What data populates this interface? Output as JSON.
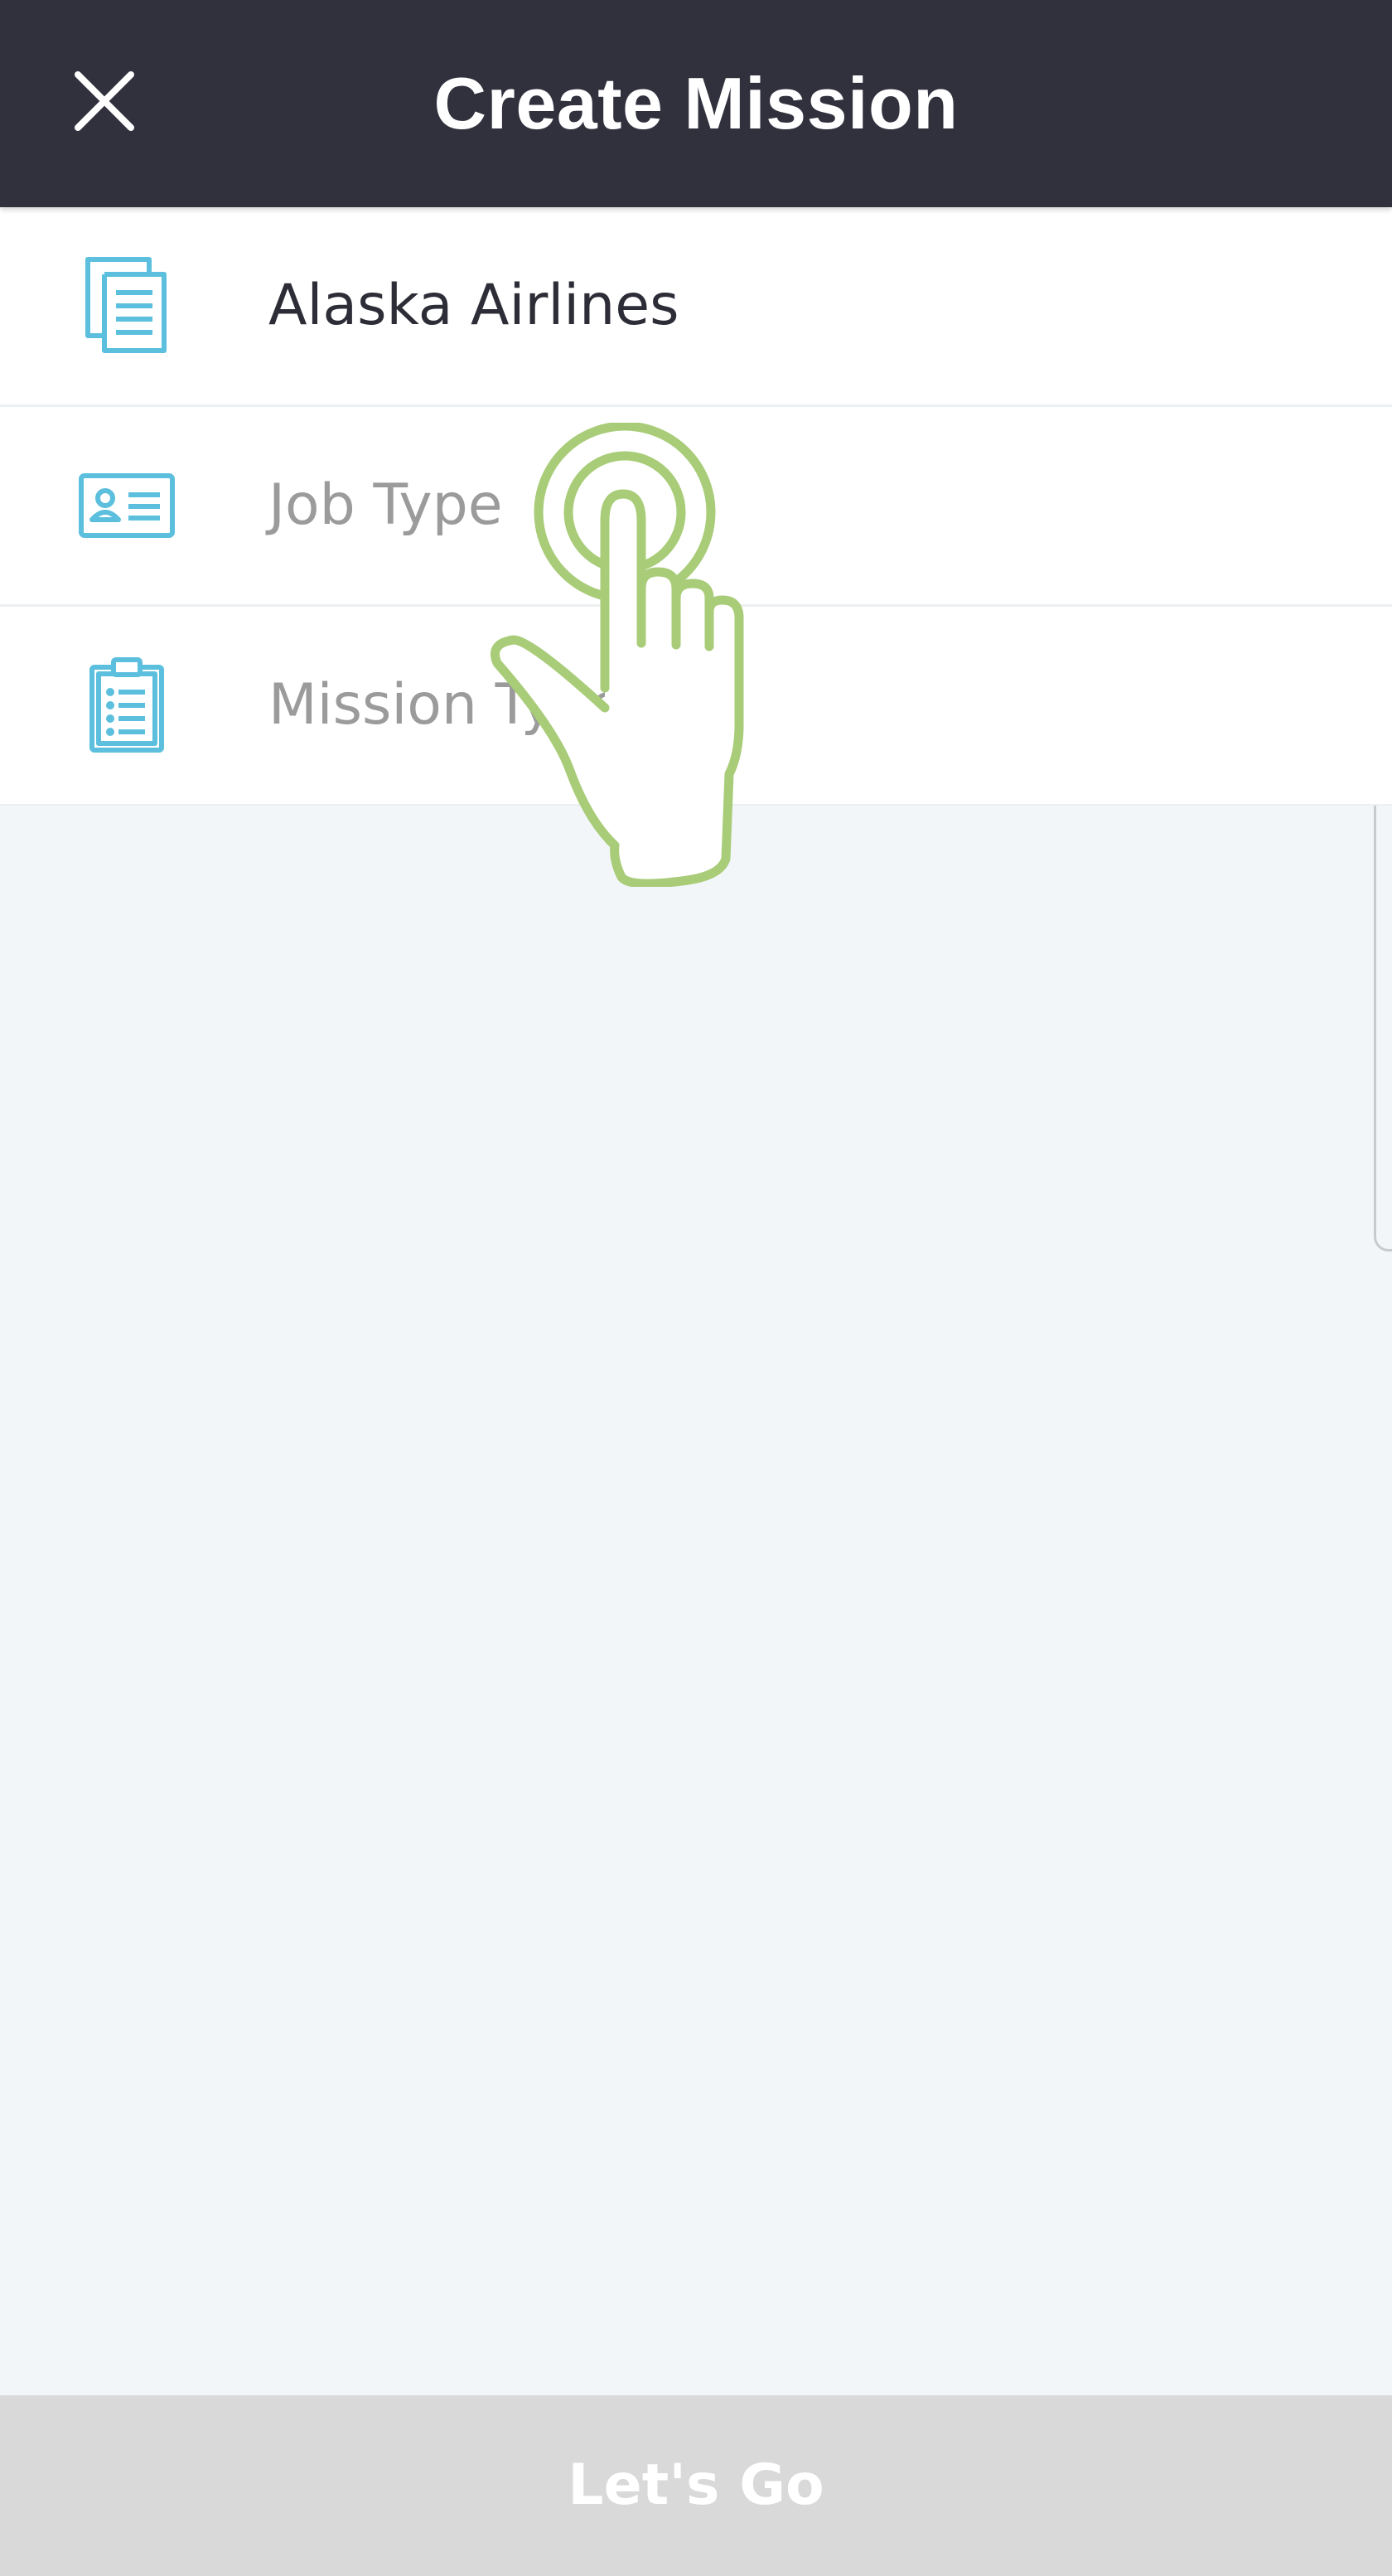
{
  "header": {
    "title": "Create Mission",
    "close_icon": "close-icon"
  },
  "form": {
    "fields": [
      {
        "icon": "document-icon",
        "value": "Alaska Airlines",
        "placeholder": ""
      },
      {
        "icon": "id-card-icon",
        "value": "",
        "placeholder": "Job Type"
      },
      {
        "icon": "clipboard-icon",
        "value": "",
        "placeholder": "Mission Type"
      }
    ]
  },
  "footer": {
    "submit_label": "Let's Go"
  },
  "overlay": {
    "hint_icon": "tap-hand-icon"
  },
  "colors": {
    "header_bg": "#30313d",
    "accent_icon": "#5bbfdd",
    "hint": "#a8cc78",
    "footer_disabled": "#d9d9d9"
  }
}
